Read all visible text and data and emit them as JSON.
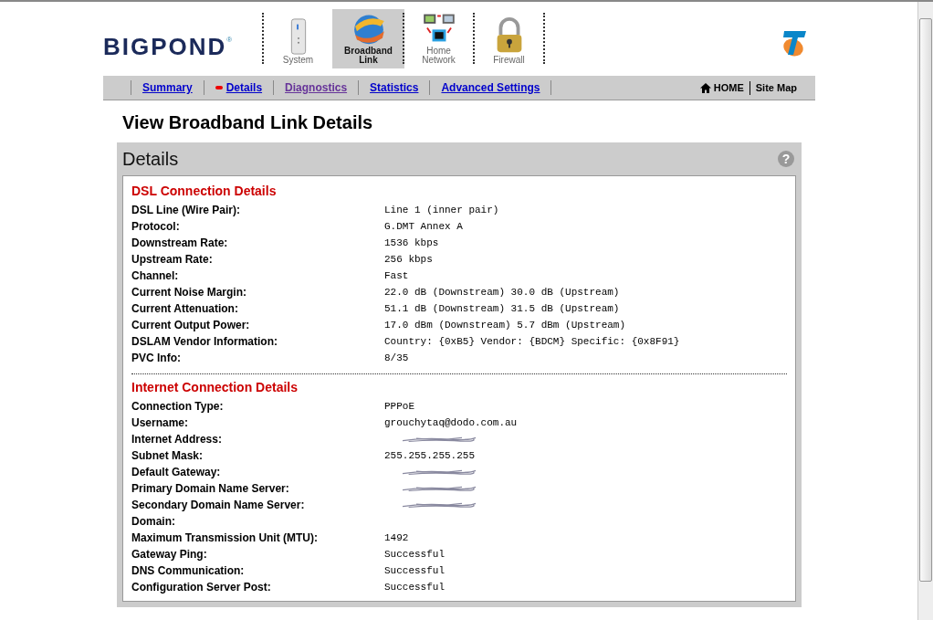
{
  "brand": {
    "name": "BIGPOND",
    "mark": "®"
  },
  "nav_tabs": [
    {
      "label": "System",
      "kind": "system",
      "selected": false
    },
    {
      "label": "Broadband Link",
      "kind": "globe",
      "selected": true
    },
    {
      "label": "Home Network",
      "kind": "network",
      "selected": false
    },
    {
      "label": "Firewall",
      "kind": "lock",
      "selected": false
    }
  ],
  "sub_nav": [
    {
      "label": "Summary",
      "current": false,
      "visited": false
    },
    {
      "label": "Details",
      "current": true,
      "visited": false
    },
    {
      "label": "Diagnostics",
      "current": false,
      "visited": true
    },
    {
      "label": "Statistics",
      "current": false,
      "visited": false
    },
    {
      "label": "Advanced Settings",
      "current": false,
      "visited": false
    }
  ],
  "utility_links": [
    {
      "label": "HOME",
      "kind": "home"
    },
    {
      "label": "Site Map"
    }
  ],
  "page_title": "View Broadband Link Details",
  "panel": {
    "title": "Details",
    "help": "?",
    "sections": [
      {
        "title": "DSL Connection Details",
        "rows": [
          {
            "label": "DSL Line (Wire Pair):",
            "value": "Line 1 (inner pair)"
          },
          {
            "label": "Protocol:",
            "value": "G.DMT Annex A"
          },
          {
            "label": "Downstream Rate:",
            "value": "1536 kbps"
          },
          {
            "label": "Upstream Rate:",
            "value": "256 kbps"
          },
          {
            "label": "Channel:",
            "value": "Fast"
          },
          {
            "label": "Current Noise Margin:",
            "value": "22.0 dB (Downstream) 30.0 dB (Upstream)"
          },
          {
            "label": "Current Attenuation:",
            "value": "51.1 dB (Downstream) 31.5 dB (Upstream)"
          },
          {
            "label": "Current Output Power:",
            "value": "17.0 dBm (Downstream) 5.7 dBm (Upstream)"
          },
          {
            "label": "DSLAM Vendor Information:",
            "value": "Country: {0xB5} Vendor: {BDCM} Specific: {0x8F91}"
          },
          {
            "label": "PVC Info:",
            "value": "8/35"
          }
        ]
      },
      {
        "title": "Internet Connection Details",
        "rows": [
          {
            "label": "Connection Type:",
            "value": "PPPoE"
          },
          {
            "label": "Username:",
            "value": "grouchytaq@dodo.com.au"
          },
          {
            "label": "Internet Address:",
            "redacted": true
          },
          {
            "label": "Subnet Mask:",
            "value": "255.255.255.255"
          },
          {
            "label": "Default Gateway:",
            "redacted": true
          },
          {
            "label": "Primary Domain Name Server:",
            "redacted": true
          },
          {
            "label": "Secondary Domain Name Server:",
            "redacted": true
          },
          {
            "label": "Domain:"
          },
          {
            "label": "Maximum Transmission Unit (MTU):",
            "value": "1492"
          },
          {
            "label": "Gateway Ping:",
            "value": "Successful"
          },
          {
            "label": "DNS Communication:",
            "value": "Successful"
          },
          {
            "label": "Configuration Server Post:",
            "value": "Successful"
          }
        ]
      }
    ]
  }
}
